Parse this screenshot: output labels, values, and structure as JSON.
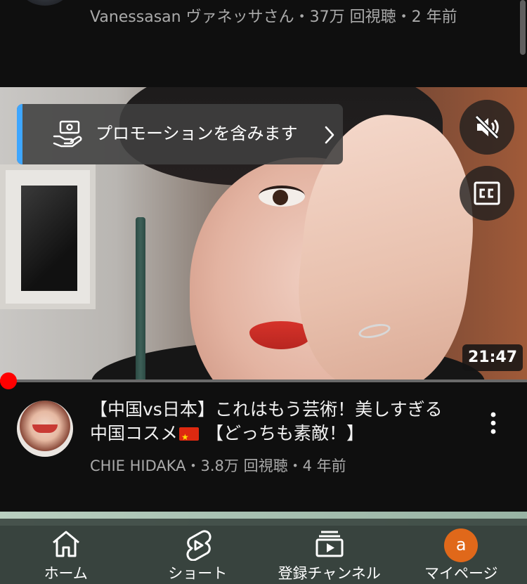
{
  "previous_item": {
    "meta_line": "Vanessasan ヴァネッサさん・37万 回視聴・2 年前"
  },
  "video": {
    "promo_label": "プロモーションを含みます",
    "duration": "21:47",
    "progress": 0.01,
    "icons": {
      "promo": "hand-coins-icon",
      "promo_chevron": "chevron-right-icon",
      "mute": "volume-muted-icon",
      "captions": "closed-captions-icon"
    },
    "colors": {
      "progress": "#ff0000",
      "promo_accent": "#3ea6ff"
    }
  },
  "video_info": {
    "title_part1": "【中国vs日本】これはもう芸術！美しすぎる中国コスメ",
    "title_part2": " 【どっちも素敵！】",
    "flag_icon": "china-flag-icon",
    "meta_line": "CHIE HIDAKA・3.8万 回視聴・4 年前",
    "more_icon": "more-vertical-icon"
  },
  "bottom_nav": {
    "items": [
      {
        "label": "ホーム",
        "icon": "home-icon"
      },
      {
        "label": "ショート",
        "icon": "shorts-icon"
      },
      {
        "label": "登録チャンネル",
        "icon": "subscriptions-icon"
      },
      {
        "label": "マイページ",
        "icon": "account-avatar"
      }
    ],
    "account_initial": "a",
    "account_color": "#e0681a"
  }
}
